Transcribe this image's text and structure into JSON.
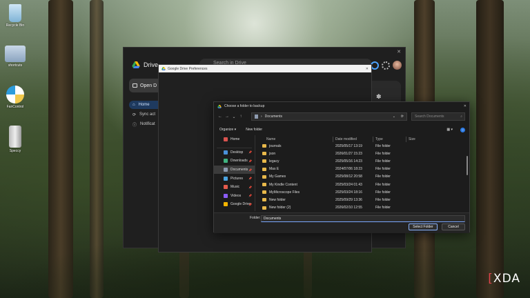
{
  "desktop": {
    "icons": [
      {
        "label": "Recycle Bin",
        "icon": "recycle-bin-icon"
      },
      {
        "label": "shortcuts",
        "icon": "folder-icon"
      },
      {
        "label": "FanControl",
        "icon": "fan-icon"
      },
      {
        "label": "Speccy",
        "icon": "speccy-icon"
      }
    ],
    "watermark": "XDA"
  },
  "drive": {
    "brand": "Drive",
    "search_placeholder": "Search in Drive",
    "open_drive": "Open D",
    "nav": [
      {
        "label": "Home",
        "icon": "home-icon",
        "active": true
      },
      {
        "label": "Sync act",
        "icon": "sync-icon",
        "active": false
      },
      {
        "label": "Notificat",
        "icon": "info-icon",
        "active": false
      }
    ]
  },
  "preferences": {
    "title": "Google Drive Preferences"
  },
  "picker": {
    "title": "Choose a folder to backup",
    "address": "Documents",
    "search_placeholder": "Search Documents",
    "organize": "Organize",
    "new_folder": "New folder",
    "sidebar": [
      {
        "label": "Home",
        "icon": "home-icon",
        "color": "#d9534f",
        "pinned": false
      },
      {
        "label": "Desktop",
        "icon": "desktop-icon",
        "color": "#4a90d9",
        "pinned": true
      },
      {
        "label": "Downloads",
        "icon": "download-icon",
        "color": "#3fb27f",
        "pinned": true
      },
      {
        "label": "Documents",
        "icon": "document-icon",
        "color": "#8e9bb0",
        "pinned": true,
        "active": true
      },
      {
        "label": "Pictures",
        "icon": "pictures-icon",
        "color": "#4aa3df",
        "pinned": true
      },
      {
        "label": "Music",
        "icon": "music-icon",
        "color": "#e55b4d",
        "pinned": true
      },
      {
        "label": "Videos",
        "icon": "videos-icon",
        "color": "#8b5cf6",
        "pinned": true
      },
      {
        "label": "Google Drive",
        "icon": "google-drive-icon",
        "color": "#f4b400",
        "pinned": true
      }
    ],
    "columns": {
      "name": "Name",
      "date": "Date modified",
      "type": "Type",
      "size": "Size"
    },
    "files": [
      {
        "name": "journals",
        "date": "2025/05/17 13:19",
        "type": "File folder"
      },
      {
        "name": "json",
        "date": "2026/01/27 15:23",
        "type": "File folder"
      },
      {
        "name": "legacy",
        "date": "2025/05/16 14:23",
        "type": "File folder"
      },
      {
        "name": "Mas E",
        "date": "2024/07/06 18:23",
        "type": "File folder"
      },
      {
        "name": "My Games",
        "date": "2025/08/12 20:58",
        "type": "File folder"
      },
      {
        "name": "My Kindle Content",
        "date": "2025/03/24 01:43",
        "type": "File folder"
      },
      {
        "name": "MyMicroscope Files",
        "date": "2025/03/24 18:16",
        "type": "File folder"
      },
      {
        "name": "New folder",
        "date": "2025/09/29 13:36",
        "type": "File folder"
      },
      {
        "name": "New folder (2)",
        "date": "2026/02/10 12:55",
        "type": "File folder"
      }
    ],
    "folder_label": "Folder:",
    "folder_value": "Documents",
    "select_button": "Select Folder",
    "cancel_button": "Cancel"
  }
}
